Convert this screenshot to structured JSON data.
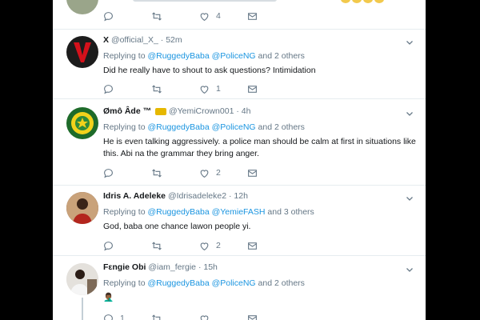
{
  "top": {
    "like_count": "4"
  },
  "tweets": [
    {
      "name": "X",
      "handle": "@official_X_",
      "time": "· 52m",
      "replying_prefix": "Replying to",
      "mention1": "@RuggedyBaba",
      "mention2": "@PoliceNG",
      "others": "and 2 others",
      "text": "Did he really have to shout to ask questions? Intimidation",
      "reply_count": "",
      "retweet_count": "",
      "like_count": "1"
    },
    {
      "name": "Ømô Âde ™",
      "handle": "@YemiCrown001",
      "time": "· 4h",
      "replying_prefix": "Replying to",
      "mention1": "@RuggedyBaba",
      "mention2": "@PoliceNG",
      "others": "and 2 others",
      "text": "He is even talking aggressively. a police man should be calm at first in situations like this. Abi na the grammar they bring anger.",
      "reply_count": "",
      "retweet_count": "",
      "like_count": "2"
    },
    {
      "name": "Idris A. Adeleke",
      "handle": "@Idrisadeleke2",
      "time": "· 12h",
      "replying_prefix": "Replying to",
      "mention1": "@RuggedyBaba",
      "mention2": "@YemieFASH",
      "others": "and 3 others",
      "text": "God, baba one chance lawon people yi.",
      "reply_count": "",
      "retweet_count": "",
      "like_count": "2"
    },
    {
      "name": "Fεngie Obi",
      "handle": "@iam_fergie",
      "time": "· 15h",
      "replying_prefix": "Replying to",
      "mention1": "@RuggedyBaba",
      "mention2": "@PoliceNG",
      "others": "and 2 others",
      "text": "🤦🏾‍♂️",
      "reply_count": "1",
      "retweet_count": "",
      "like_count": ""
    }
  ],
  "colors": {
    "link": "#1b95e0",
    "muted": "#657786",
    "text": "#14171a"
  }
}
